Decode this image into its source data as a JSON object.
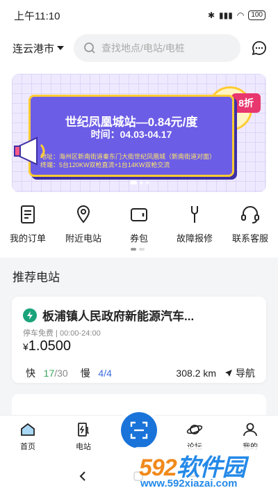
{
  "status": {
    "time": "上午11:10",
    "battery": "100"
  },
  "header": {
    "city": "连云港市",
    "search_placeholder": "查找地点/电站/电桩"
  },
  "banner": {
    "title": "世纪凤凰城站—0.84元/度",
    "time": "时间：04.03-04.17",
    "address": "地址：海州区新南街道秦东门大街世纪凤凰城（新南街道对面）",
    "terminals": "终端：5台120KW双枪直流+1台14KW双枪交流",
    "discount": "8折"
  },
  "quick_actions": [
    {
      "label": "我的订单",
      "icon": "order-icon"
    },
    {
      "label": "附近电站",
      "icon": "location-icon"
    },
    {
      "label": "券包",
      "icon": "wallet-icon"
    },
    {
      "label": "故障报修",
      "icon": "wrench-icon"
    },
    {
      "label": "联系客服",
      "icon": "headset-icon"
    }
  ],
  "section_title": "推荐电站",
  "station": {
    "name": "板浦镇人民政府新能源汽车...",
    "meta": "停车免费 | 00:00-24:00",
    "price_symbol": "¥",
    "price": "1.0500",
    "fast_label": "快",
    "fast_available": "17",
    "fast_total": "/30",
    "slow_label": "慢",
    "slow_available": "4",
    "slow_total": "/4",
    "distance": "308.2 km",
    "navigate": "导航"
  },
  "tabs": [
    {
      "label": "首页",
      "icon": "home-icon"
    },
    {
      "label": "电站",
      "icon": "charger-icon"
    },
    {
      "label": "",
      "icon": "scan-icon"
    },
    {
      "label": "论坛",
      "icon": "planet-icon"
    },
    {
      "label": "我的",
      "icon": "user-icon"
    }
  ],
  "watermark": {
    "brand_num": "592",
    "brand_text": "软件园",
    "url": "www.592xiazai.com"
  },
  "colors": {
    "primary": "#1a73d9",
    "banner": "#6c5de6",
    "accent": "#e8366e",
    "green": "#3aa55c"
  }
}
